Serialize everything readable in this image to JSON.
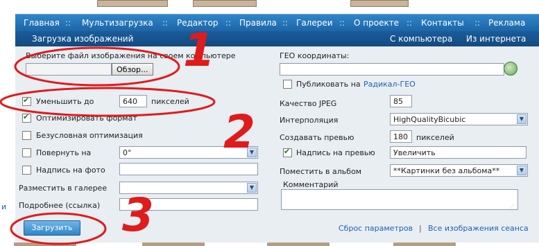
{
  "nav": {
    "items": [
      "Главная",
      "Мультизагрузка",
      "Редактор",
      "Правила",
      "Галереи",
      "О проекте",
      "Контакты",
      "Реклама"
    ]
  },
  "subnav": {
    "title": "Загрузка изображений",
    "link_computer": "С компьютера",
    "link_internet": "Из интернета"
  },
  "form": {
    "file_label": "Выберите файл изображения на своем компьютере",
    "browse_label": "Обзор...",
    "resize_label": "Уменьшить до",
    "resize_value": "640",
    "resize_unit": "пикселей",
    "optimize_label": "Оптимизировать формат",
    "force_opt_label": "Безусловная оптимизация",
    "rotate_label": "Повернуть на",
    "rotate_value": "0°",
    "caption_label": "Надпись на фото",
    "caption_value": "",
    "gallery_label": "Разместить в галерее",
    "gallery_value": "",
    "details_label": "Подробнее (ссылка)",
    "details_value": "",
    "geo_label": "ГЕО координаты:",
    "geo_value": "",
    "publish_label": "Публиковать на",
    "publish_link": "Радикал-ГЕО",
    "jpeg_label": "Качество JPEG",
    "jpeg_value": "85",
    "interp_label": "Интерполяция",
    "interp_value": "HighQualityBicubic",
    "preview_label": "Создавать превью",
    "preview_value": "180",
    "preview_unit": "пикселей",
    "preview_caption_label": "Надпись на превью",
    "preview_caption_value": "Увеличить",
    "album_label": "Поместить в альбом",
    "album_value": "**Картинки без альбома**",
    "comment_label": "Комментарий",
    "comment_value": "",
    "upload_button": "Загрузить",
    "reset_link": "Сброс параметров",
    "link_sep": "|",
    "all_images_link": "Все изображения сеанса"
  },
  "annotations": [
    "1",
    "2",
    "3"
  ],
  "colors": {
    "nav_bg": "#2f86c8",
    "subnav_bg": "#1a5c9b",
    "panel_bg": "#e9eef3",
    "annotation_red": "#e01b1b",
    "link_blue": "#1d62b0"
  },
  "left_margin_char": "и"
}
